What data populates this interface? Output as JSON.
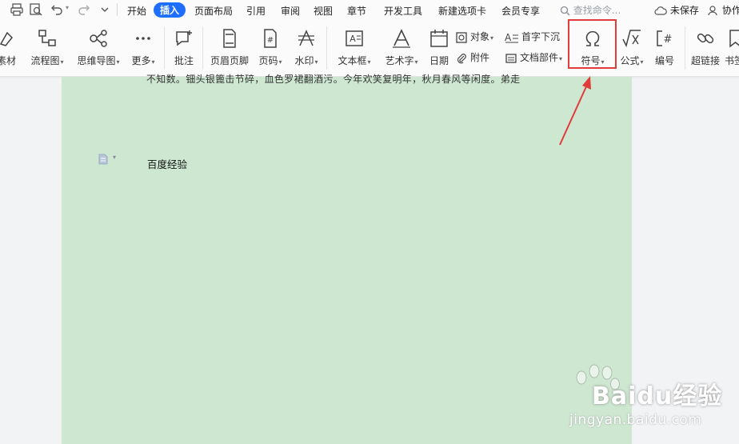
{
  "menubar": {
    "tabs": [
      "开始",
      "插入",
      "页面布局",
      "引用",
      "审阅",
      "视图",
      "章节",
      "开发工具",
      "新建选项卡",
      "会员专享"
    ],
    "active_tab": "插入",
    "search_placeholder": "查找命令...",
    "save_status": "未保存",
    "collab_label": "协作"
  },
  "ribbon": {
    "material": "素材",
    "flowchart": "流程图",
    "mindmap": "思维导图",
    "more": "更多",
    "comment": "批注",
    "header_footer": "页眉页脚",
    "page_number": "页码",
    "watermark": "水印",
    "textbox": "文本框",
    "wordart": "艺术字",
    "date": "日期",
    "object": "对象",
    "attachment": "附件",
    "dropcap": "首字下沉",
    "doc_parts": "文档部件",
    "symbol": "符号",
    "formula": "公式",
    "numbering": "编号",
    "hyperlink": "超链接",
    "bookmark": "书签"
  },
  "document": {
    "partial_line": "不知数。钿头银篦击节碎，血色罗裙翻酒污。今年欢笑复明年，秋月春风等闲度。弟走",
    "text": "百度经验"
  },
  "watermark": {
    "brand": "Baidu经验",
    "url": "jingyan.baidu.com"
  },
  "colors": {
    "active_tab": "#1e6fff",
    "page_background": "#cde7d0",
    "highlight": "#e23b3b"
  }
}
